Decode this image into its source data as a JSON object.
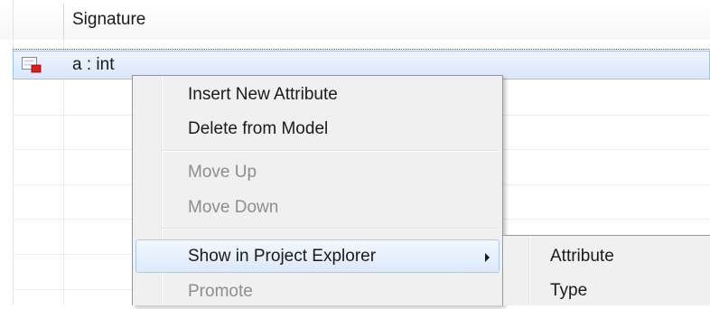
{
  "table": {
    "header": {
      "signature_label": "Signature"
    },
    "selected_row": {
      "icon": "attribute-icon",
      "text": "a : int"
    }
  },
  "context_menu": {
    "items": [
      {
        "label": "Insert New Attribute",
        "enabled": true
      },
      {
        "label": "Delete from Model",
        "enabled": true
      },
      {
        "label": "Move Up",
        "enabled": false
      },
      {
        "label": "Move Down",
        "enabled": false
      },
      {
        "label": "Show in Project Explorer",
        "enabled": true,
        "submenu": true,
        "hovered": true
      },
      {
        "label": "Promote",
        "enabled": false
      }
    ]
  },
  "submenu": {
    "items": [
      {
        "label": "Attribute"
      },
      {
        "label": "Type"
      }
    ]
  },
  "colors": {
    "selection_fill": "#d9e7fa",
    "selection_border": "#9ec1ef",
    "menu_bg": "#f0f0f0",
    "disabled_text": "#8d8d8d",
    "icon_red": "#e02020"
  }
}
